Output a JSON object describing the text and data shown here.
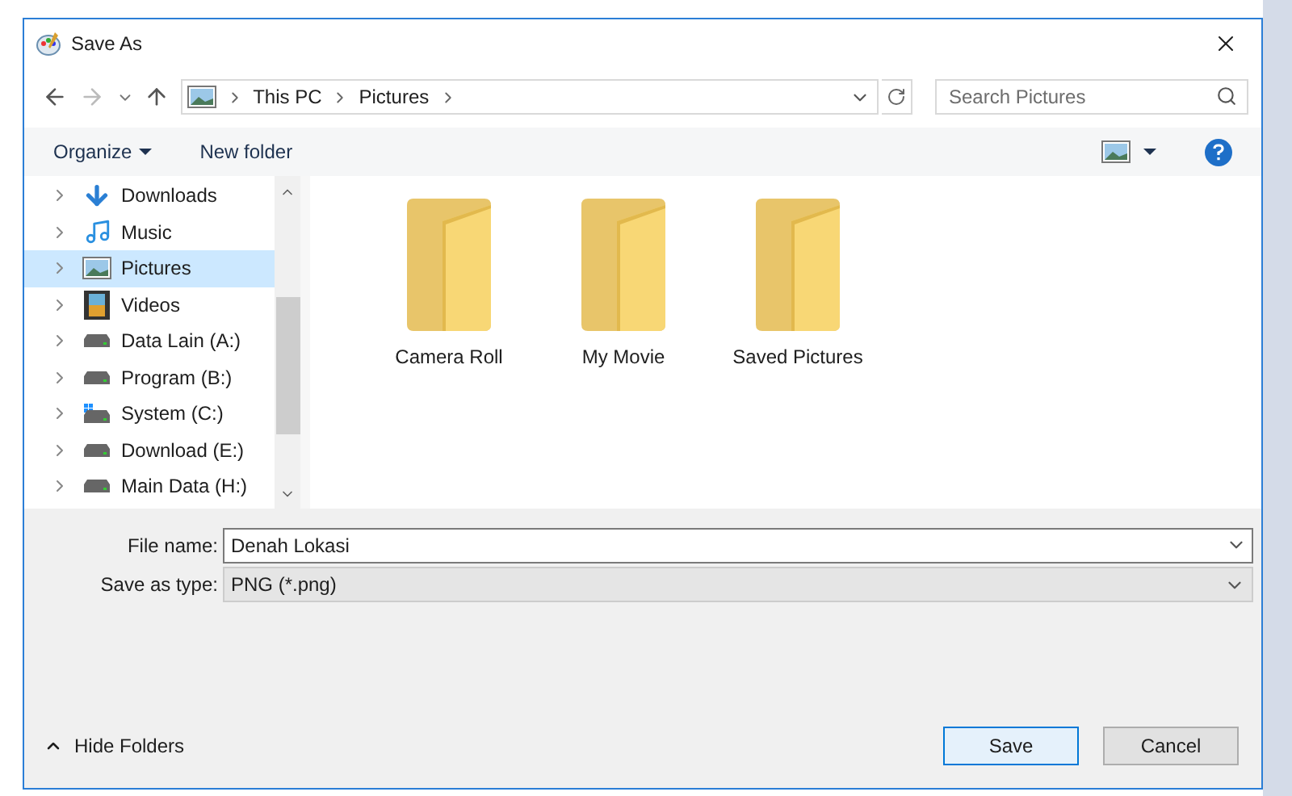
{
  "window": {
    "title": "Save As"
  },
  "address": {
    "crumbs": [
      "This PC",
      "Pictures"
    ]
  },
  "search": {
    "placeholder": "Search Pictures"
  },
  "toolbar": {
    "organize": "Organize",
    "new_folder": "New folder"
  },
  "sidebar": {
    "items": [
      {
        "label": "Downloads",
        "kind": "downloads",
        "selected": false
      },
      {
        "label": "Music",
        "kind": "music",
        "selected": false
      },
      {
        "label": "Pictures",
        "kind": "pictures",
        "selected": true
      },
      {
        "label": "Videos",
        "kind": "videos",
        "selected": false
      },
      {
        "label": "Data Lain (A:)",
        "kind": "drive",
        "selected": false
      },
      {
        "label": "Program (B:)",
        "kind": "drive",
        "selected": false
      },
      {
        "label": "System (C:)",
        "kind": "system",
        "selected": false
      },
      {
        "label": "Download (E:)",
        "kind": "drive",
        "selected": false
      },
      {
        "label": "Main Data (H:)",
        "kind": "drive",
        "selected": false
      }
    ]
  },
  "folders": [
    "Camera Roll",
    "My Movie",
    "Saved Pictures"
  ],
  "form": {
    "file_name_label": "File name:",
    "file_name": "Denah Lokasi",
    "type_label": "Save as type:",
    "type": "PNG (*.png)"
  },
  "footer": {
    "hide_folders": "Hide Folders",
    "save": "Save",
    "cancel": "Cancel"
  }
}
